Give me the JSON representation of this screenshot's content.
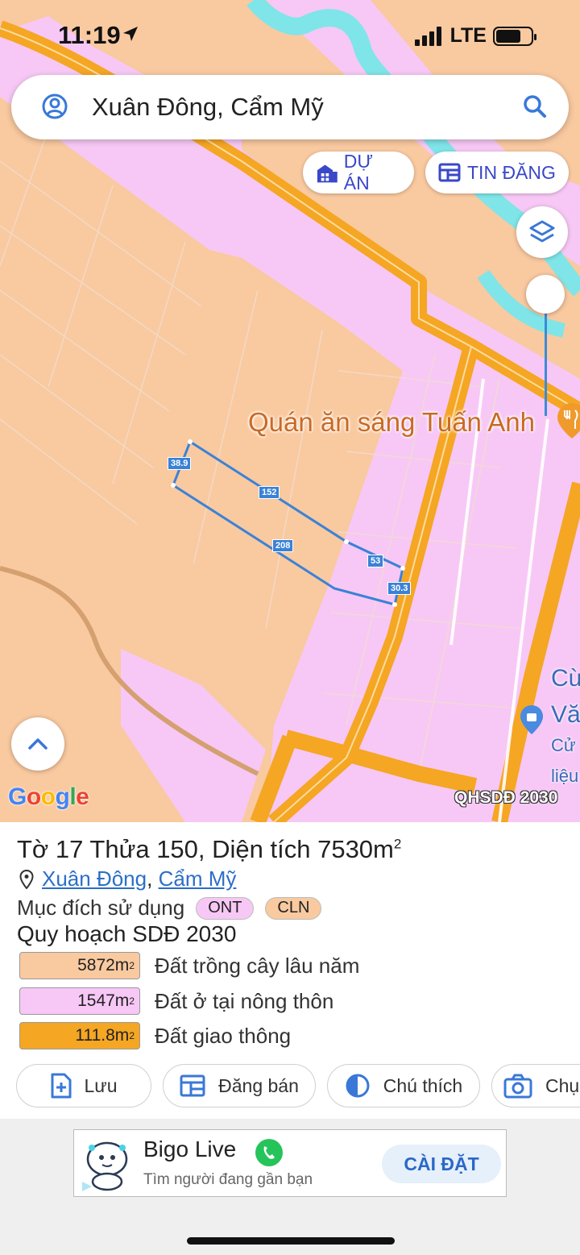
{
  "status": {
    "time": "11:19",
    "network": "LTE"
  },
  "search": {
    "query": "Xuân Đông, Cẩm Mỹ"
  },
  "chips": {
    "du_an": "DỰ ÁN",
    "tin_dang": "TIN ĐĂNG"
  },
  "map": {
    "poi_name": "Quán ăn sáng Tuấn Anh",
    "side_lines": [
      "Cừ",
      "Vă",
      "Cử",
      "liệu"
    ],
    "google": "Google",
    "badge": "QHSDĐ 2030",
    "dimensions": [
      "38.9",
      "152",
      "208",
      "53",
      "30.3"
    ],
    "colors": {
      "land_orange": "#f9c9a0",
      "land_pink": "#f7c8f5",
      "road": "#f5a623",
      "water": "#7fe5e8",
      "parcel_outline": "#3a82d6"
    }
  },
  "parcel": {
    "title": "Tờ 17 Thửa 150, Diện tích 7530m",
    "title_sup": "2",
    "location_commune": "Xuân Đông",
    "location_sep": ",",
    "location_district": "Cẩm Mỹ",
    "purpose_label": "Mục đích sử dụng",
    "purpose_tags": [
      "ONT",
      "CLN"
    ],
    "plan_title": "Quy hoạch SDĐ 2030",
    "legend": [
      {
        "area": "5872m",
        "sup": "2",
        "label": "Đất trồng cây lâu năm",
        "color": "#f9c9a0"
      },
      {
        "area": "1547m",
        "sup": "2",
        "label": "Đất ở tại nông thôn",
        "color": "#f7c8f5"
      },
      {
        "area": "111.8m",
        "sup": "2",
        "label": "Đất giao thông",
        "color": "#f5a623"
      }
    ]
  },
  "actions": {
    "save": "Lưu",
    "sell": "Đăng bán",
    "legend": "Chú thích",
    "capture": "Chụ"
  },
  "ad": {
    "title": "Bigo Live",
    "subtitle": "Tìm người đang gần bạn",
    "cta": "CÀI ĐẶT"
  }
}
